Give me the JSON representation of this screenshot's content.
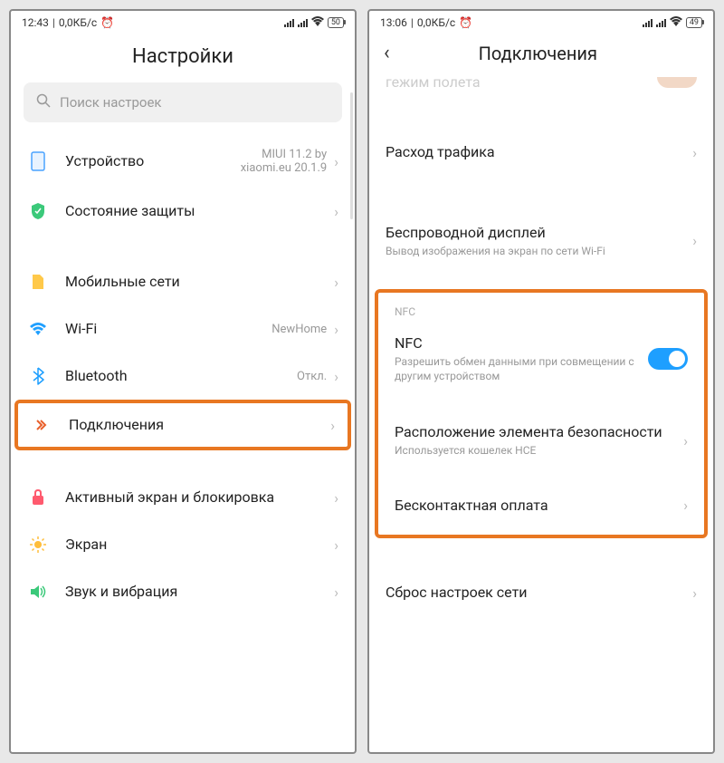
{
  "left": {
    "status": {
      "time": "12:43",
      "net": "0,0КБ/с",
      "battery": "50"
    },
    "title": "Настройки",
    "search_placeholder": "Поиск настроек",
    "items": [
      {
        "label": "Устройство",
        "value": "MIUI 11.2 by xiaomi.eu 20.1.9"
      },
      {
        "label": "Состояние защиты"
      },
      {
        "label": "Мобильные сети"
      },
      {
        "label": "Wi-Fi",
        "value": "NewHome"
      },
      {
        "label": "Bluetooth",
        "value": "Откл."
      },
      {
        "label": "Подключения"
      },
      {
        "label": "Активный экран и блокировка"
      },
      {
        "label": "Экран"
      },
      {
        "label": "Звук и вибрация"
      }
    ]
  },
  "right": {
    "status": {
      "time": "13:06",
      "net": "0,0КБ/с",
      "battery": "49"
    },
    "title": "Подключения",
    "partial_top": "гежим полета",
    "items": [
      {
        "label": "Расход трафика"
      },
      {
        "label": "Беспроводной дисплей",
        "sub": "Вывод изображения на экран по сети Wi-Fi"
      }
    ],
    "nfc_header": "NFC",
    "nfc_block": [
      {
        "label": "NFC",
        "sub": "Разрешить обмен данными при совмещении с другим устройством",
        "toggle": true
      },
      {
        "label": "Расположение элемента безопасности",
        "sub": "Используется кошелек HCE"
      },
      {
        "label": "Бесконтактная оплата"
      }
    ],
    "reset": {
      "label": "Сброс настроек сети"
    }
  }
}
